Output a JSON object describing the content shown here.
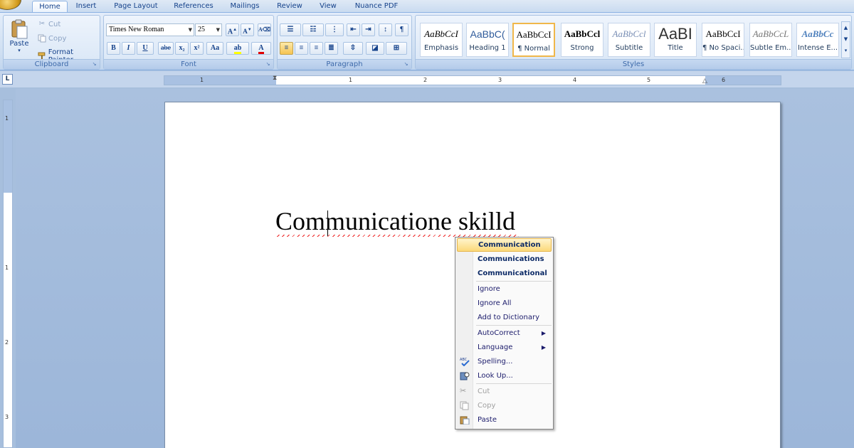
{
  "tabs": [
    {
      "label": "Home",
      "active": true
    },
    {
      "label": "Insert"
    },
    {
      "label": "Page Layout"
    },
    {
      "label": "References"
    },
    {
      "label": "Mailings"
    },
    {
      "label": "Review"
    },
    {
      "label": "View"
    },
    {
      "label": "Nuance PDF"
    }
  ],
  "clipboard": {
    "label": "Clipboard",
    "paste": "Paste",
    "cut": "Cut",
    "copy": "Copy",
    "format_painter": "Format Painter"
  },
  "font": {
    "label": "Font",
    "family": "Times New Roman",
    "size": "25",
    "grow": "A",
    "shrink": "A",
    "bold": "B",
    "italic": "I",
    "underline": "U",
    "strike": "abe",
    "subscript": "x₂",
    "superscript": "x²",
    "change_case": "Aa",
    "font_color": "A"
  },
  "paragraph": {
    "label": "Paragraph"
  },
  "styles": {
    "label": "Styles",
    "items": [
      {
        "sample": "AaBbCcI",
        "name": "Emphasis"
      },
      {
        "sample": "AaBbC(",
        "name": "Heading 1"
      },
      {
        "sample": "AaBbCcI",
        "name": "¶ Normal",
        "selected": true
      },
      {
        "sample": "AaBbCcl",
        "name": "Strong"
      },
      {
        "sample": "AaBbCcl",
        "name": "Subtitle"
      },
      {
        "sample": "AaBI",
        "name": "Title"
      },
      {
        "sample": "AaBbCcI",
        "name": "¶ No Spaci..."
      },
      {
        "sample": "AaBbCcL",
        "name": "Subtle Em..."
      },
      {
        "sample": "AaBbCc",
        "name": "Intense E..."
      }
    ]
  },
  "ruler": {
    "tab_selector": "L",
    "h_numbers": [
      "1",
      "1",
      "2",
      "3",
      "4",
      "5",
      "6"
    ],
    "v_numbers": [
      "1",
      "1",
      "2",
      "3"
    ]
  },
  "document": {
    "text": "Communicatione skilld"
  },
  "context_menu": {
    "suggestions": [
      "Communication",
      "Communications",
      "Communicational"
    ],
    "ignore": "Ignore",
    "ignore_all": "Ignore All",
    "add_to_dictionary": "Add to Dictionary",
    "autocorrect": "AutoCorrect",
    "language": "Language",
    "spelling": "Spelling...",
    "look_up": "Look Up...",
    "cut": "Cut",
    "copy": "Copy",
    "paste": "Paste"
  }
}
